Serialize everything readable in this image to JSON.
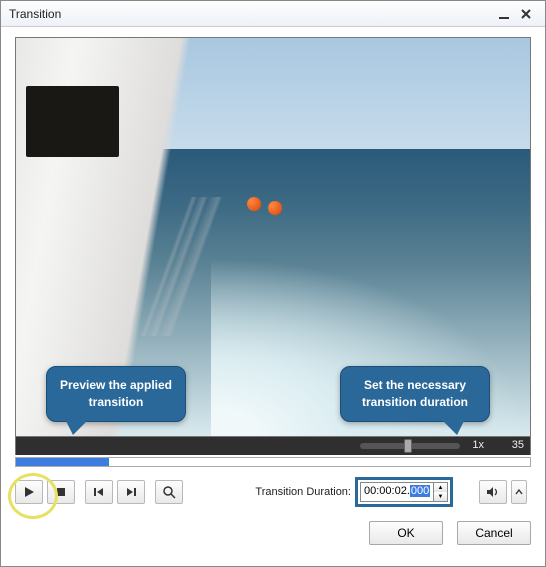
{
  "title": "Transition",
  "callouts": {
    "preview": "Preview the applied transition",
    "duration": "Set the necessary transition duration"
  },
  "playback": {
    "speed": "1x",
    "timestamp_suffix": "35"
  },
  "duration": {
    "label": "Transition Duration:",
    "value_prefix": "00:00:02.",
    "value_selected": "000"
  },
  "buttons": {
    "ok": "OK",
    "cancel": "Cancel"
  }
}
